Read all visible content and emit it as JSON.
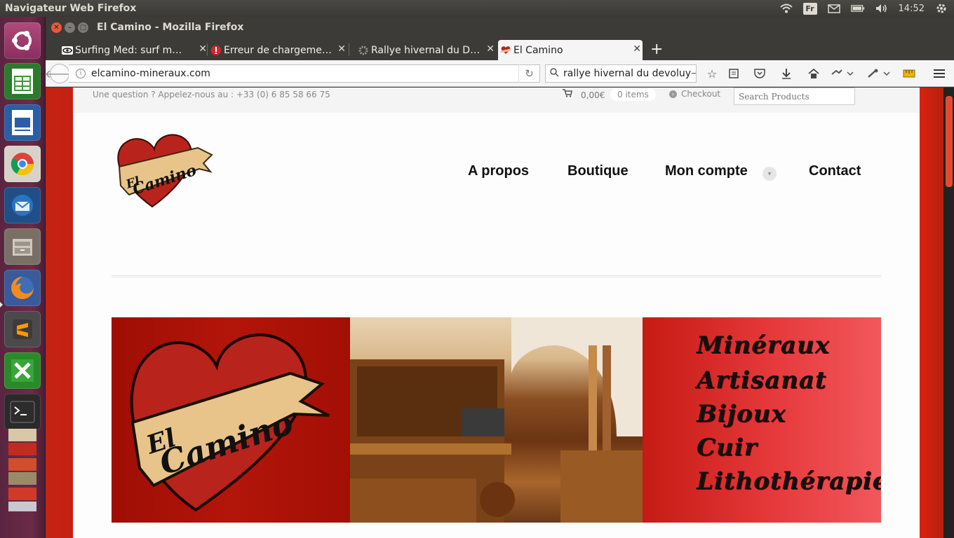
{
  "system": {
    "app_title": "Navigateur Web Firefox",
    "keyboard_layout": "Fr",
    "clock": "14:52"
  },
  "window": {
    "title": "El Camino - Mozilla Firefox"
  },
  "tabs": [
    {
      "label": "Surfing Med: surf m…",
      "favicon": "eye-icon"
    },
    {
      "label": "Erreur de chargeme…",
      "favicon": "error-icon"
    },
    {
      "label": "Rallye hivernal du D…",
      "favicon": "gear-icon"
    },
    {
      "label": "El Camino",
      "favicon": "heart-icon",
      "active": true
    }
  ],
  "navbar": {
    "url": "elcamino-mineraux.com",
    "search_value": "rallye hivernal du devoluy"
  },
  "site": {
    "question": "Une question ? Appelez-nous au : +33 (0) 6 85 58 66 75",
    "cart_total": "0,00€",
    "cart_items": "0 items",
    "checkout": "Checkout",
    "search_placeholder": "Search Products",
    "logo_text_1": "El",
    "logo_text_2": "Camino",
    "nav": [
      "A propos",
      "Boutique",
      "Mon compte",
      "Contact"
    ],
    "banner": {
      "logo_text_1": "El",
      "logo_text_2": "Camino",
      "taglines": [
        "Minéraux",
        "Artisanat",
        "Bijoux",
        "Cuir",
        "Lithothérapie"
      ]
    }
  },
  "colors": {
    "accent": "#c32312",
    "launcher": "#6b2b47"
  }
}
